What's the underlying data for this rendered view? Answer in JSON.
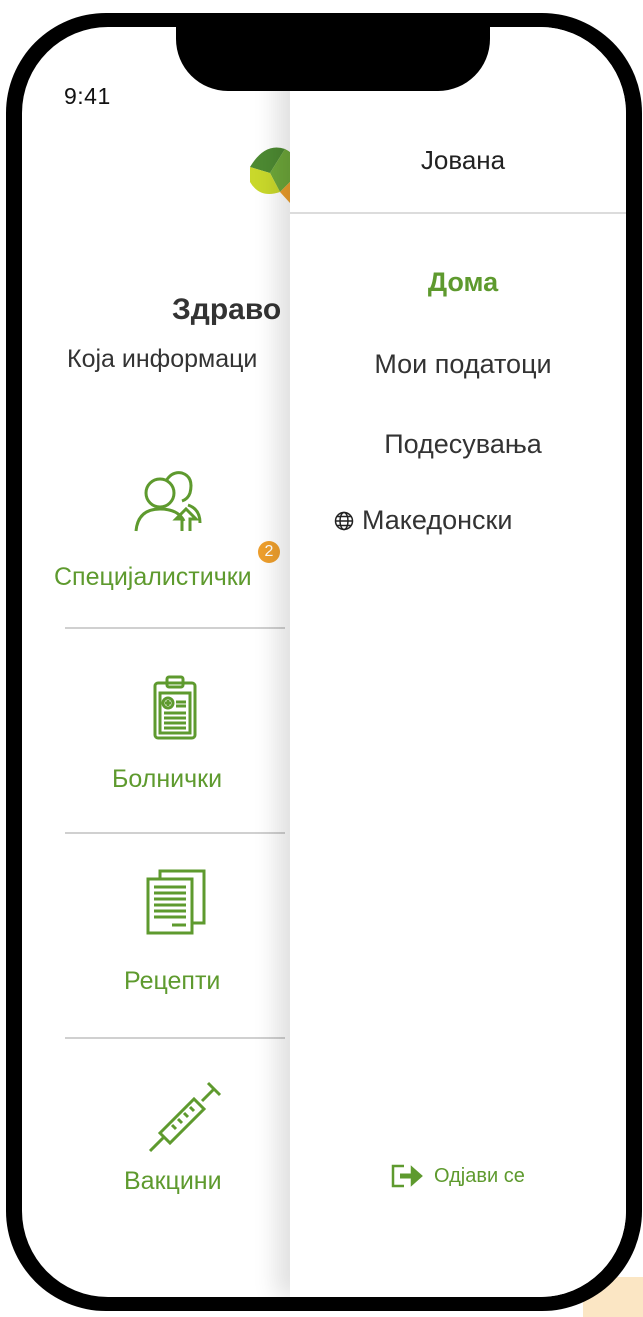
{
  "status_bar": {
    "time": "9:41"
  },
  "home": {
    "title": "Здраво",
    "subtitle": "Која информаци",
    "tiles": [
      {
        "label": "Специјалистички",
        "badge": "2",
        "icon": "specialists-icon"
      },
      {
        "label": "Болнички",
        "icon": "clipboard-icon"
      },
      {
        "label": "Рецепти",
        "icon": "documents-icon"
      },
      {
        "label": "Вакцини",
        "icon": "syringe-icon"
      }
    ]
  },
  "drawer": {
    "user_name": "Јована",
    "menu": [
      {
        "label": "Дома",
        "active": true
      },
      {
        "label": "Мои податоци",
        "active": false
      },
      {
        "label": "Подесувања",
        "active": false
      }
    ],
    "language": {
      "label": "Македонски",
      "icon": "globe-icon"
    },
    "logout": {
      "label": "Одјави се",
      "icon": "logout-icon"
    }
  },
  "colors": {
    "accent_green": "#5e9a2e",
    "badge_orange": "#ee9f2d",
    "logo_yellow": "#c9d82b",
    "logo_dark_green": "#4d8a32"
  }
}
